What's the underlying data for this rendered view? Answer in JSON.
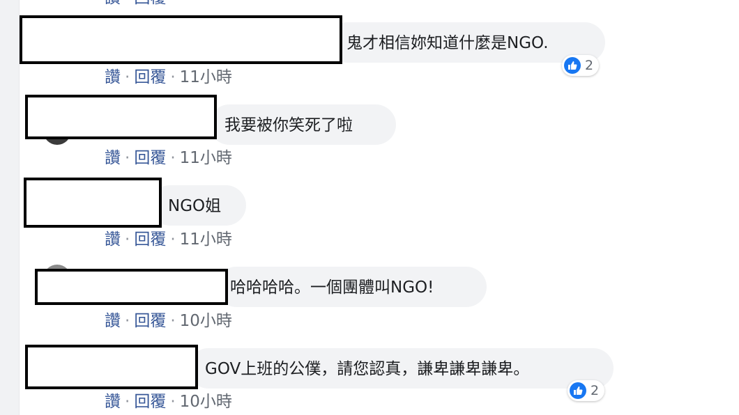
{
  "comments": [
    {
      "text": "鬼才相信妳知道什麼是NGO.",
      "like": "讚",
      "sep": "·",
      "reply": "回覆",
      "time": "11小時",
      "reactions": "2"
    },
    {
      "text": "我要被你笑死了啦",
      "like": "讚",
      "sep": "·",
      "reply": "回覆",
      "time": "11小時"
    },
    {
      "text": "NGO姐",
      "like": "讚",
      "sep": "·",
      "reply": "回覆",
      "time": "11小時"
    },
    {
      "text": "哈哈哈哈。一個團體叫NGO!",
      "like": "讚",
      "sep": "·",
      "reply": "回覆",
      "time": "10小時"
    },
    {
      "text": "GOV上班的公僕，請您認真，謙卑謙卑謙卑。",
      "like": "讚",
      "sep": "·",
      "reply": "回覆",
      "time": "10小時",
      "reactions": "2"
    }
  ],
  "colors": {
    "link": "#385898",
    "bubble": "#f2f3f5",
    "like": "#1877f2"
  },
  "icons": {
    "reaction": "thumbs-up-icon"
  }
}
